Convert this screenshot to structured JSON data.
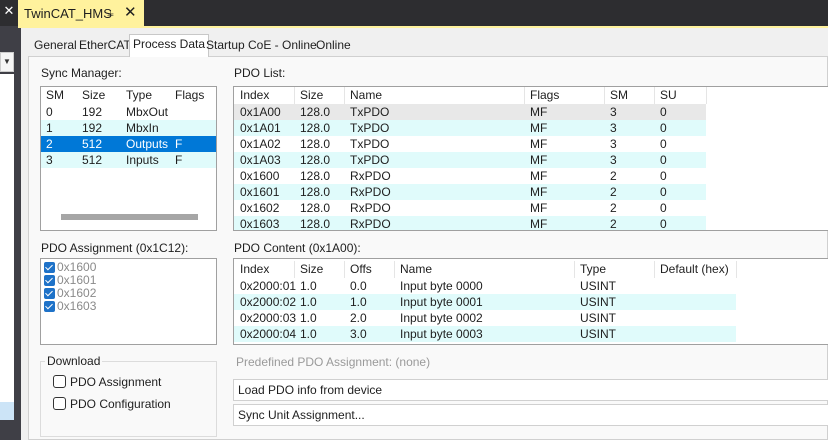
{
  "window": {
    "doc_tab_title": "TwinCAT_HMS",
    "pin_glyph": "⫨",
    "close_glyph": "✕",
    "left_close_glyph": "✕"
  },
  "tabs": [
    "General",
    "EtherCAT",
    "Process Data",
    "Startup",
    "CoE - Online",
    "Online"
  ],
  "active_tab": "Process Data",
  "sync_manager": {
    "label": "Sync Manager:",
    "columns": [
      "SM",
      "Size",
      "Type",
      "Flags"
    ],
    "rows": [
      [
        "0",
        "192",
        "MbxOut",
        ""
      ],
      [
        "1",
        "192",
        "MbxIn",
        ""
      ],
      [
        "2",
        "512",
        "Outputs",
        "F"
      ],
      [
        "3",
        "512",
        "Inputs",
        "F"
      ]
    ],
    "selected_row": 2
  },
  "pdo_list": {
    "label": "PDO List:",
    "columns": [
      "Index",
      "Size",
      "Name",
      "Flags",
      "SM",
      "SU"
    ],
    "rows": [
      [
        "0x1A00",
        "128.0",
        "TxPDO",
        "MF",
        "3",
        "0"
      ],
      [
        "0x1A01",
        "128.0",
        "TxPDO",
        "MF",
        "3",
        "0"
      ],
      [
        "0x1A02",
        "128.0",
        "TxPDO",
        "MF",
        "3",
        "0"
      ],
      [
        "0x1A03",
        "128.0",
        "TxPDO",
        "MF",
        "3",
        "0"
      ],
      [
        "0x1600",
        "128.0",
        "RxPDO",
        "MF",
        "2",
        "0"
      ],
      [
        "0x1601",
        "128.0",
        "RxPDO",
        "MF",
        "2",
        "0"
      ],
      [
        "0x1602",
        "128.0",
        "RxPDO",
        "MF",
        "2",
        "0"
      ],
      [
        "0x1603",
        "128.0",
        "RxPDO",
        "MF",
        "2",
        "0"
      ]
    ]
  },
  "pdo_assignment": {
    "label": "PDO Assignment (0x1C12):",
    "items": [
      "0x1600",
      "0x1601",
      "0x1602",
      "0x1603"
    ]
  },
  "pdo_content": {
    "label": "PDO Content (0x1A00):",
    "columns": [
      "Index",
      "Size",
      "Offs",
      "Name",
      "Type",
      "Default (hex)"
    ],
    "rows": [
      [
        "0x2000:01",
        "1.0",
        "0.0",
        "Input byte 0000",
        "USINT",
        ""
      ],
      [
        "0x2000:02",
        "1.0",
        "1.0",
        "Input byte 0001",
        "USINT",
        ""
      ],
      [
        "0x2000:03",
        "1.0",
        "2.0",
        "Input byte 0002",
        "USINT",
        ""
      ],
      [
        "0x2000:04",
        "1.0",
        "3.0",
        "Input byte 0003",
        "USINT",
        ""
      ]
    ]
  },
  "download": {
    "label": "Download",
    "pdo_assignment_label": "PDO Assignment",
    "pdo_configuration_label": "PDO Configuration"
  },
  "predefined_label": "Predefined PDO Assignment: (none)",
  "load_pdo_label": "Load PDO info from device",
  "sync_unit_label": "Sync Unit Assignment...",
  "colors": {
    "tab_accent": "#fff29d",
    "selection": "#0078d7",
    "alt_row": "#e0fbfb",
    "checkbox": "#1e72c8"
  }
}
